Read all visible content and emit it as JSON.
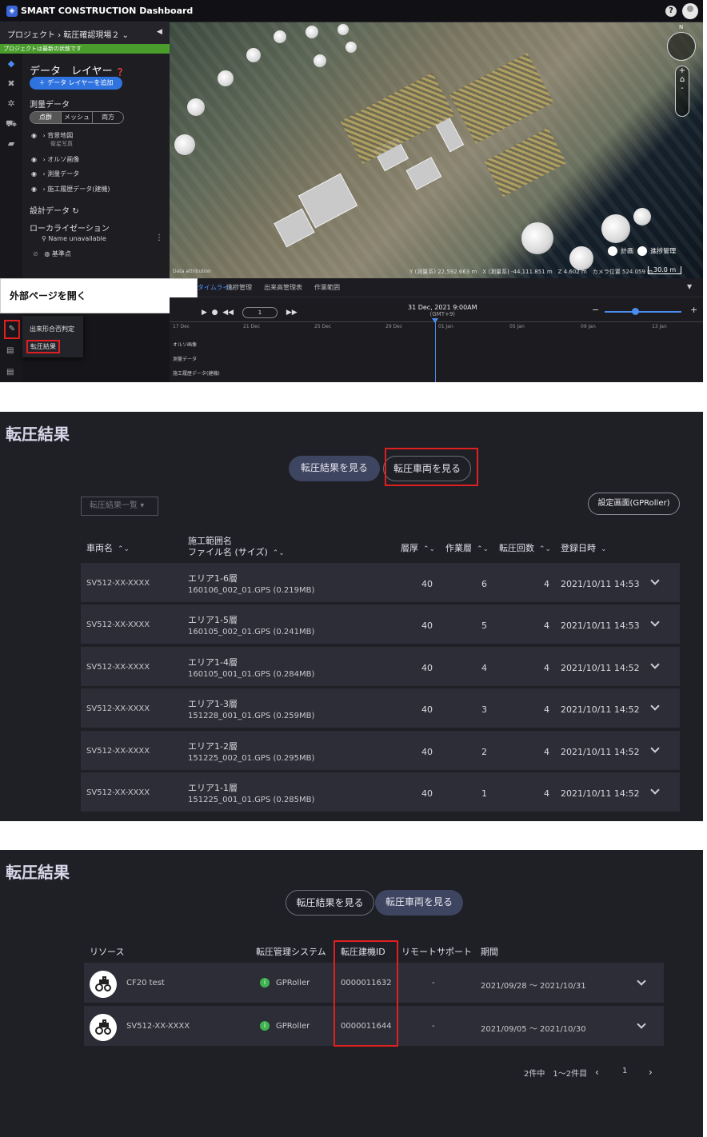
{
  "dashboard": {
    "app_title": "SMART CONSTRUCTION Dashboard",
    "project": "プロジェクト › 転圧確認現場２ ⌄",
    "project_status": "プロジェクトは最新の状態です",
    "layers_title": "データ　レイヤー",
    "add_layer": "＋ データ レイヤーを追加",
    "survey_section": "測量データ",
    "seg_options": [
      "点群",
      "メッシュ",
      "両方"
    ],
    "layers": [
      {
        "name": "背景地図",
        "sub": "衛星写真"
      },
      {
        "name": "オルソ画像",
        "sub": ""
      },
      {
        "name": "測量データ",
        "sub": ""
      },
      {
        "name": "施工履歴データ(建機)",
        "sub": ""
      }
    ],
    "design_section": "設計データ",
    "localization_section": "ローカライゼーション",
    "location_name": "Name unavailable",
    "reference_point": "基準点",
    "map_toggle_plan": "計画",
    "map_toggle_progress": "進捗管理",
    "coords_text": "Y (測量系) 22,592.663 m　X (測量系) -44,111.851 m　Z 4.602 m　カメラ位置 524.059 m",
    "scale_text": "30.0 m",
    "attribution": "Data attribution",
    "compass_n": "N",
    "callout_label": "外部ページを開く",
    "timeline_tabs": [
      "タイムライン",
      "進捗管理",
      "出来高管理表",
      "作業範囲"
    ],
    "menu_items": [
      "出来形合否判定",
      "転圧結果"
    ],
    "timeline_date": "31 Dec, 2021 9:00AM",
    "timeline_tz": "(GMT+9)",
    "timeline_input": "1",
    "timeline_ticks": [
      "17 Dec",
      "21 Dec",
      "25 Dec",
      "29 Dec",
      "01 Jan",
      "05 Jan",
      "09 Jan",
      "13 Jan"
    ],
    "timeline_rows": [
      "オルソ画像",
      "測量データ",
      "施工履歴データ(建機)"
    ]
  },
  "results": {
    "title": "転圧結果",
    "btn_results": "転圧結果を見る",
    "btn_vehicles": "転圧車両を見る",
    "dropdown": "転圧結果一覧",
    "settings_button": "設定画面(GPRoller)",
    "headers": {
      "vehicle": "車両名",
      "area": "施工範囲名",
      "file": "ファイル名 (サイズ)",
      "thickness": "層厚",
      "work_layer": "作業層",
      "passes": "転圧回数",
      "registered": "登録日時"
    },
    "rows": [
      {
        "vehicle": "SV512-XX-XXXX",
        "area": "エリア1-6層",
        "file": "160106_002_01.GPS (0.219MB)",
        "thickness": "40",
        "layer": "6",
        "passes": "4",
        "date": "2021/10/11 14:53"
      },
      {
        "vehicle": "SV512-XX-XXXX",
        "area": "エリア1-5層",
        "file": "160105_002_01.GPS (0.241MB)",
        "thickness": "40",
        "layer": "5",
        "passes": "4",
        "date": "2021/10/11 14:53"
      },
      {
        "vehicle": "SV512-XX-XXXX",
        "area": "エリア1-4層",
        "file": "160105_001_01.GPS (0.284MB)",
        "thickness": "40",
        "layer": "4",
        "passes": "4",
        "date": "2021/10/11 14:52"
      },
      {
        "vehicle": "SV512-XX-XXXX",
        "area": "エリア1-3層",
        "file": "151228_001_01.GPS (0.259MB)",
        "thickness": "40",
        "layer": "3",
        "passes": "4",
        "date": "2021/10/11 14:52"
      },
      {
        "vehicle": "SV512-XX-XXXX",
        "area": "エリア1-2層",
        "file": "151225_002_01.GPS (0.295MB)",
        "thickness": "40",
        "layer": "2",
        "passes": "4",
        "date": "2021/10/11 14:52"
      },
      {
        "vehicle": "SV512-XX-XXXX",
        "area": "エリア1-1層",
        "file": "151225_001_01.GPS (0.285MB)",
        "thickness": "40",
        "layer": "1",
        "passes": "4",
        "date": "2021/10/11 14:52"
      }
    ]
  },
  "vehicles": {
    "title": "転圧結果",
    "btn_results": "転圧結果を見る",
    "btn_vehicles": "転圧車両を見る",
    "headers": {
      "resource": "リソース",
      "system": "転圧管理システム",
      "machine_id": "転圧建機ID",
      "remote": "リモートサポート",
      "period": "期間"
    },
    "rows": [
      {
        "name": "CF20 test",
        "system": "GPRoller",
        "id": "0000011632",
        "remote": "-",
        "period": "2021/09/28 ～ 2021/10/31"
      },
      {
        "name": "SV512-XX-XXXX",
        "system": "GPRoller",
        "id": "0000011644",
        "remote": "-",
        "period": "2021/09/05 ～ 2021/10/30"
      }
    ],
    "pager_text": "2件中　1～2件目",
    "page_number": "1"
  }
}
